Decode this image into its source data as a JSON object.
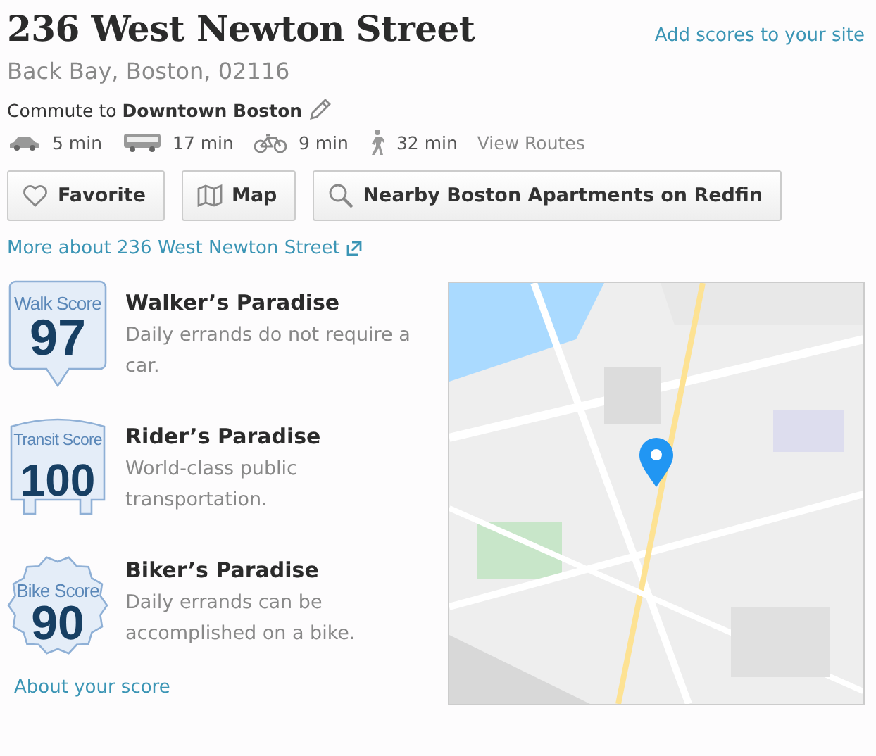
{
  "header": {
    "title": "236 West Newton Street",
    "site_link": "Add scores to your site",
    "location": "Back Bay, Boston, 02116"
  },
  "commute": {
    "prefix": "Commute to",
    "destination": "Downtown Boston",
    "modes": [
      {
        "kind": "car",
        "time": "5 min"
      },
      {
        "kind": "bus",
        "time": "17 min"
      },
      {
        "kind": "bike",
        "time": "9 min"
      },
      {
        "kind": "walk",
        "time": "32 min"
      }
    ],
    "routes_link": "View Routes"
  },
  "buttons": [
    {
      "kind": "heart",
      "label": "Favorite"
    },
    {
      "kind": "map",
      "label": "Map"
    },
    {
      "kind": "search",
      "label": "Nearby Boston Apartments on Redfin"
    }
  ],
  "more_link": "More about 236 West Newton Street",
  "scores": [
    {
      "kind": "walk",
      "badge_label": "Walk Score",
      "value": "97",
      "title": "Walker’s Paradise",
      "description": "Daily errands do not require a car."
    },
    {
      "kind": "transit",
      "badge_label": "Transit Score",
      "value": "100",
      "title": "Rider’s Paradise",
      "description": "World-class public transportation."
    },
    {
      "kind": "bike",
      "badge_label": "Bike Score",
      "value": "90",
      "title": "Biker’s Paradise",
      "description": "Daily errands can be accomplished on a bike."
    }
  ],
  "about_link": "About your score"
}
